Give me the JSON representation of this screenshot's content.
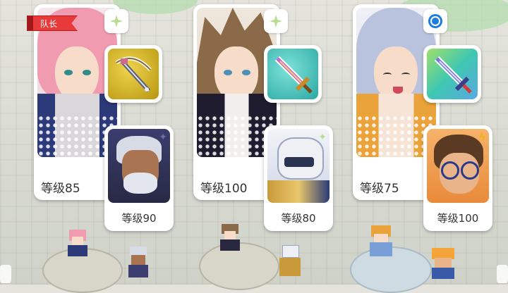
{
  "team": {
    "leader_tag": "队长",
    "slots": [
      {
        "hero_level": "等级85",
        "support_level": "等级90",
        "hair_color": "#f19bb0",
        "body_color": "#2d3a7a",
        "weapon_bg": "#d8b21a",
        "weapon_icon": "crossbow-icon",
        "badge_icon": "sparkle-icon"
      },
      {
        "hero_level": "等级100",
        "support_level": "等级80",
        "hair_color": "#8a6a48",
        "body_color": "#2a2740",
        "weapon_bg": "#3ec6c0",
        "weapon_icon": "sword-icon",
        "badge_icon": "sparkle-icon"
      },
      {
        "hero_level": "等级75",
        "support_level": "等级100",
        "hair_color": "#b9c3dd",
        "body_color": "#e9a33a",
        "weapon_bg": "#49c9b2",
        "weapon_icon": "sword-icon",
        "badge_icon": "target-icon"
      }
    ]
  },
  "colors": {
    "accent": "#e83a3a",
    "panel": "#ffffff",
    "text": "#333333"
  }
}
